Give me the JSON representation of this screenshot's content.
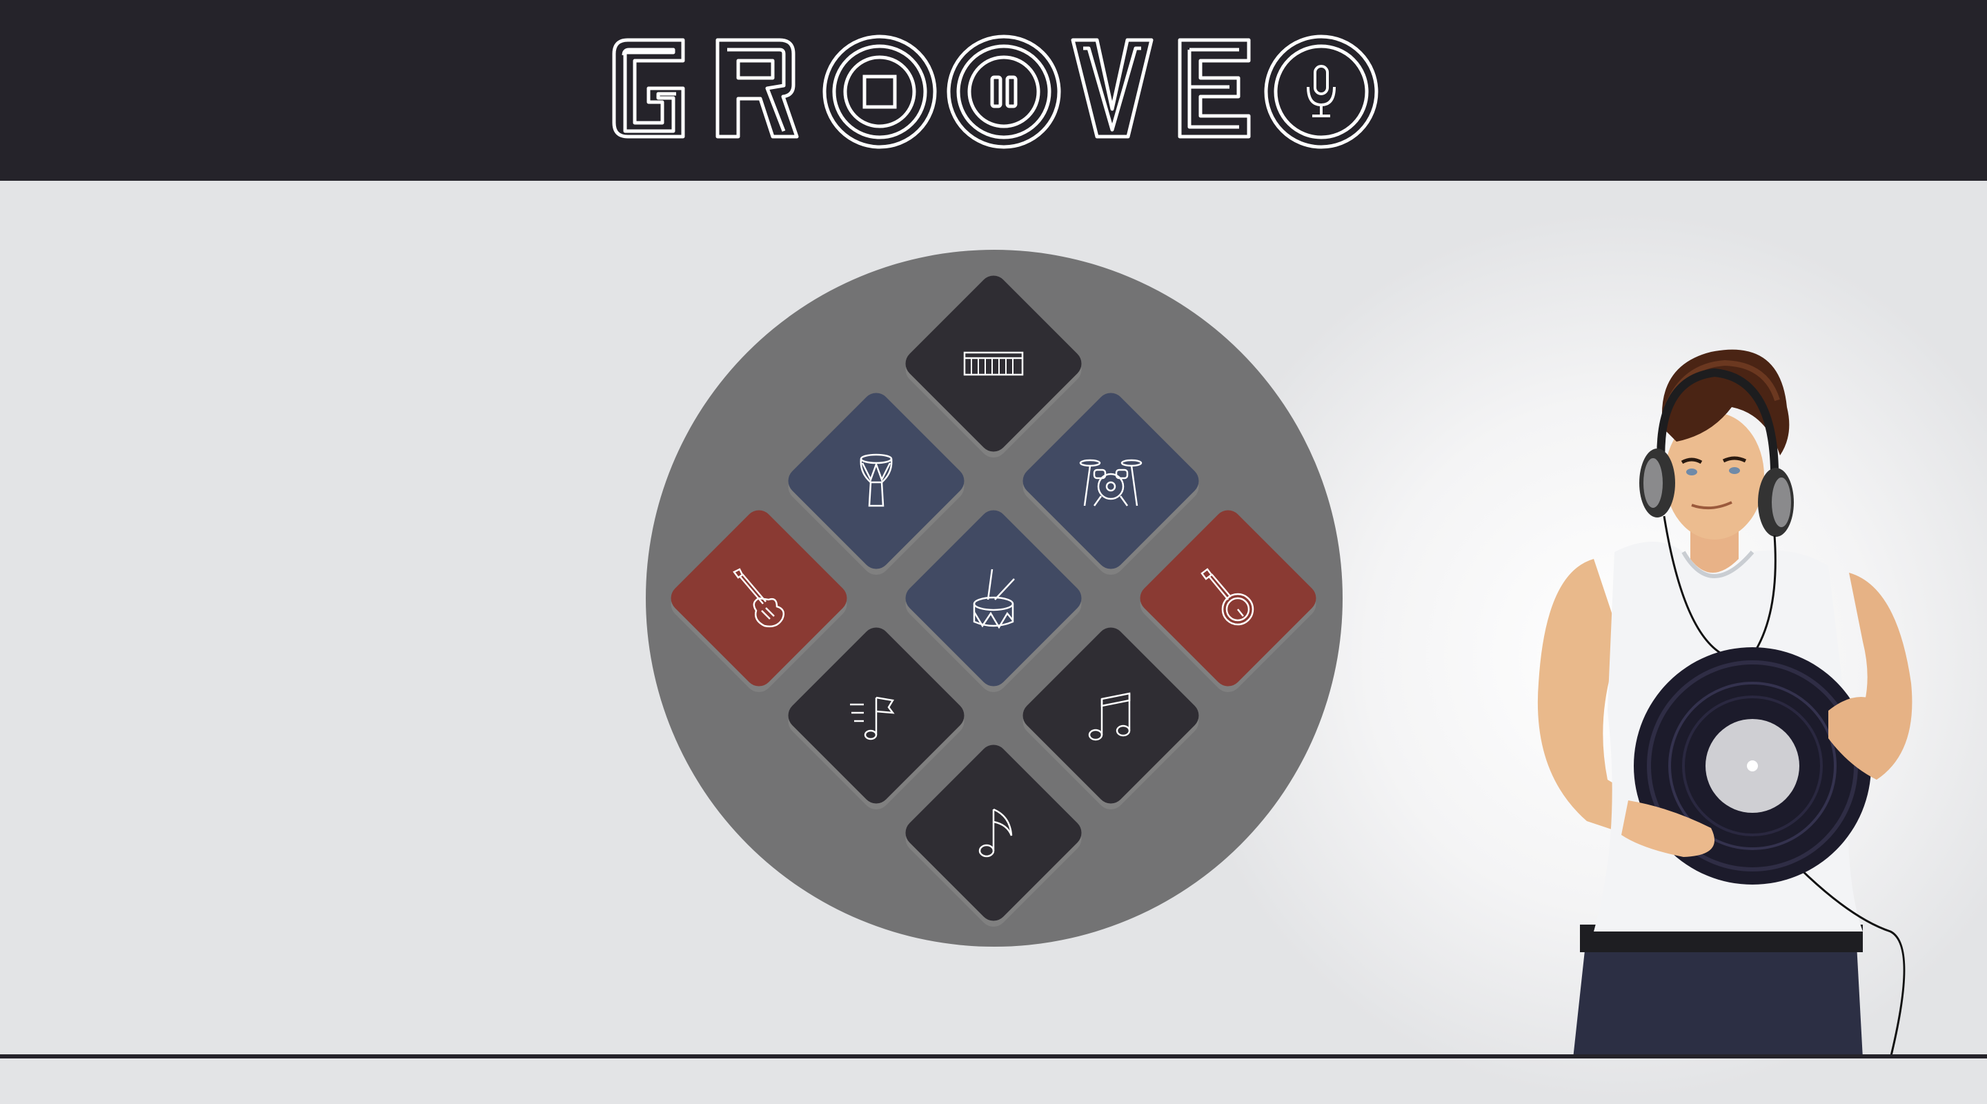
{
  "header": {
    "logo_text": "GROOVE",
    "controls": [
      {
        "name": "stop",
        "icon": "stop-icon"
      },
      {
        "name": "pause",
        "icon": "pause-icon"
      },
      {
        "name": "record",
        "icon": "microphone-icon"
      }
    ]
  },
  "pads": [
    {
      "id": "keyboard",
      "icon": "keyboard-icon",
      "color": "#2f2d33"
    },
    {
      "id": "djembe",
      "icon": "djembe-icon",
      "color": "#414a63"
    },
    {
      "id": "drum-kit",
      "icon": "drum-kit-icon",
      "color": "#414a63"
    },
    {
      "id": "electric-guitar",
      "icon": "electric-guitar-icon",
      "color": "#8a3a33"
    },
    {
      "id": "snare-drum",
      "icon": "snare-drum-icon",
      "color": "#414a63"
    },
    {
      "id": "banjo",
      "icon": "banjo-icon",
      "color": "#8a3a33"
    },
    {
      "id": "fast-notes",
      "icon": "fast-notes-icon",
      "color": "#2f2d33"
    },
    {
      "id": "beamed-notes",
      "icon": "beamed-notes-icon",
      "color": "#2f2d33"
    },
    {
      "id": "eighth-note",
      "icon": "eighth-note-icon",
      "color": "#2f2d33"
    }
  ],
  "colors": {
    "header_bg": "#25232a",
    "page_bg": "#e3e4e6",
    "pad_circle": "#737374",
    "pad_dark": "#2f2d33",
    "pad_blue": "#414a63",
    "pad_red": "#8a3a33"
  },
  "illustration": {
    "subject": "dj-holding-vinyl-record"
  }
}
